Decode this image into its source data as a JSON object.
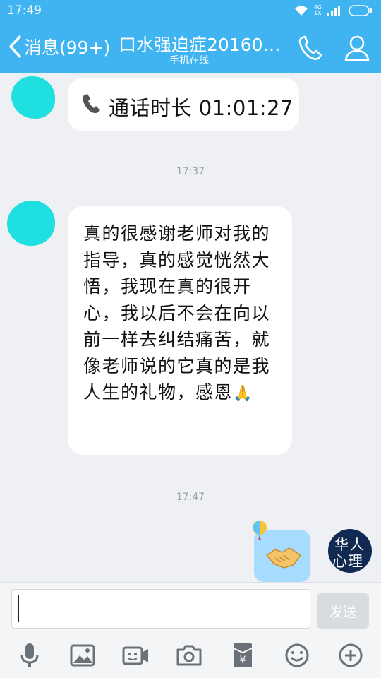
{
  "status_bar": {
    "time": "17:49",
    "network_top": "4G",
    "network_bottom": "1X"
  },
  "header": {
    "back_label": "消息(99+)",
    "title": "口水强迫症20160…",
    "subtitle": "手机在线"
  },
  "messages": [
    {
      "type": "call",
      "text": "通话时长 01:01:27"
    },
    {
      "type": "timestamp",
      "text": "17:37"
    },
    {
      "type": "text",
      "text": "真的很感谢老师对我的指导，真的感觉恍然大悟，我现在真的很开心，我以后不会在向以前一样去纠结痛苦，就像老师说的它真的是我人生的礼物，感恩",
      "emoji": "pray-emoji"
    },
    {
      "type": "timestamp",
      "text": "17:47"
    },
    {
      "type": "sticker",
      "sticker": "handshake-sticker"
    }
  ],
  "logo": {
    "line1": "华人",
    "line2": "心理"
  },
  "input": {
    "value": "",
    "placeholder": ""
  },
  "send_label": "发送",
  "toolbar_icons": [
    "microphone-icon",
    "image-icon",
    "video-icon",
    "camera-icon",
    "red-packet-icon",
    "emoji-icon",
    "plus-icon"
  ],
  "colors": {
    "header": "#3fb4f0",
    "bubble": "#ffffff",
    "sticker_bubble": "#a6dcff",
    "background": "#eef0f3"
  }
}
